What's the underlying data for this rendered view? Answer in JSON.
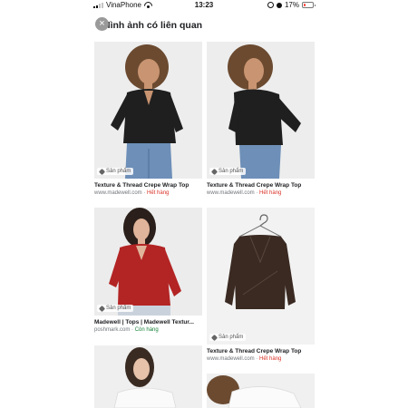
{
  "status_bar": {
    "carrier": "VinaPhone",
    "time": "13:23",
    "battery": "17%",
    "battery_level": 0.17
  },
  "header": {
    "close_glyph": "×",
    "title": "Hình ảnh có liên quan"
  },
  "colors": {
    "out_of_stock": "#d93025",
    "in_stock": "#188038"
  },
  "results": [
    {
      "chip": "Sản phẩm",
      "title": "Texture & Thread Crepe Wrap Top",
      "source": "www.madewell.com",
      "availability": "Hết hàng",
      "image": "model-black-wrap-top-front"
    },
    {
      "chip": "Sản phẩm",
      "title": "Texture & Thread Crepe Wrap Top",
      "source": "www.madewell.com",
      "availability": "Hết hàng",
      "image": "model-black-wrap-top-side"
    },
    {
      "chip": "Sản phẩm",
      "title": "Madewell | Tops | Madewell Textur...",
      "source": "poshmark.com",
      "availability": "Còn hàng",
      "image": "model-red-wrap-top"
    },
    {
      "chip": "Sản phẩm",
      "title": "Texture & Thread Crepe Wrap Top",
      "source": "www.madewell.com",
      "availability": "Hết hàng",
      "image": "brown-wrap-top-on-hanger"
    },
    {
      "image": "model-white-top"
    },
    {
      "image": "model-white-top-2"
    }
  ]
}
